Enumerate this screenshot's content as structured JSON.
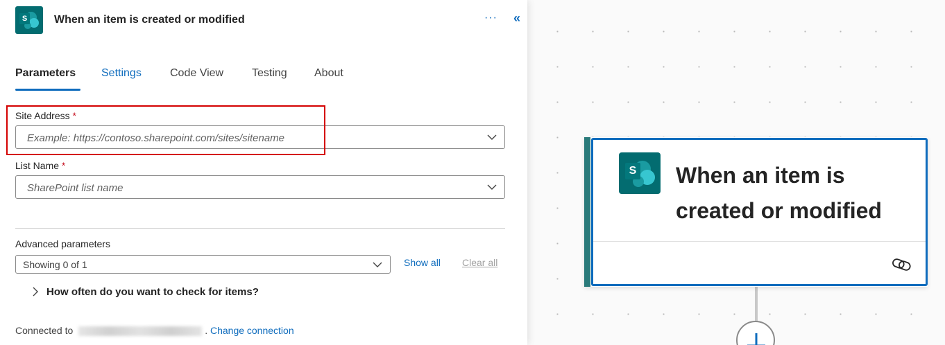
{
  "panel": {
    "title": "When an item is created or modified",
    "more_label": "···",
    "collapse_label": "«",
    "tabs": [
      {
        "label": "Parameters"
      },
      {
        "label": "Settings"
      },
      {
        "label": "Code View"
      },
      {
        "label": "Testing"
      },
      {
        "label": "About"
      }
    ],
    "active_tab": "Parameters",
    "site_address": {
      "label": "Site Address",
      "required_mark": "*",
      "placeholder": "Example: https://contoso.sharepoint.com/sites/sitename"
    },
    "list_name": {
      "label": "List Name",
      "required_mark": "*",
      "placeholder": "SharePoint list name"
    },
    "advanced": {
      "label": "Advanced parameters",
      "selected": "Showing 0 of 1",
      "show_all": "Show all",
      "clear_all": "Clear all"
    },
    "expander_text": "How often do you want to check for items?",
    "connection": {
      "prefix": "Connected to",
      "suffix": ".",
      "change_label": "Change connection"
    }
  },
  "card": {
    "logo_letter": "S",
    "title": "When an item is created or modified"
  },
  "colors": {
    "accent": "#0f6cbd",
    "sharepoint_teal": "#036c70",
    "highlight_red": "#d40000",
    "required_red": "#c50f1f"
  },
  "icons": {
    "logo": "sharepoint-icon",
    "more": "more-horizontal-icon",
    "collapse": "double-chevron-left-icon",
    "dropdown": "chevron-down-icon",
    "expander": "chevron-right-icon",
    "link": "link-icon",
    "add": "plus-icon"
  }
}
